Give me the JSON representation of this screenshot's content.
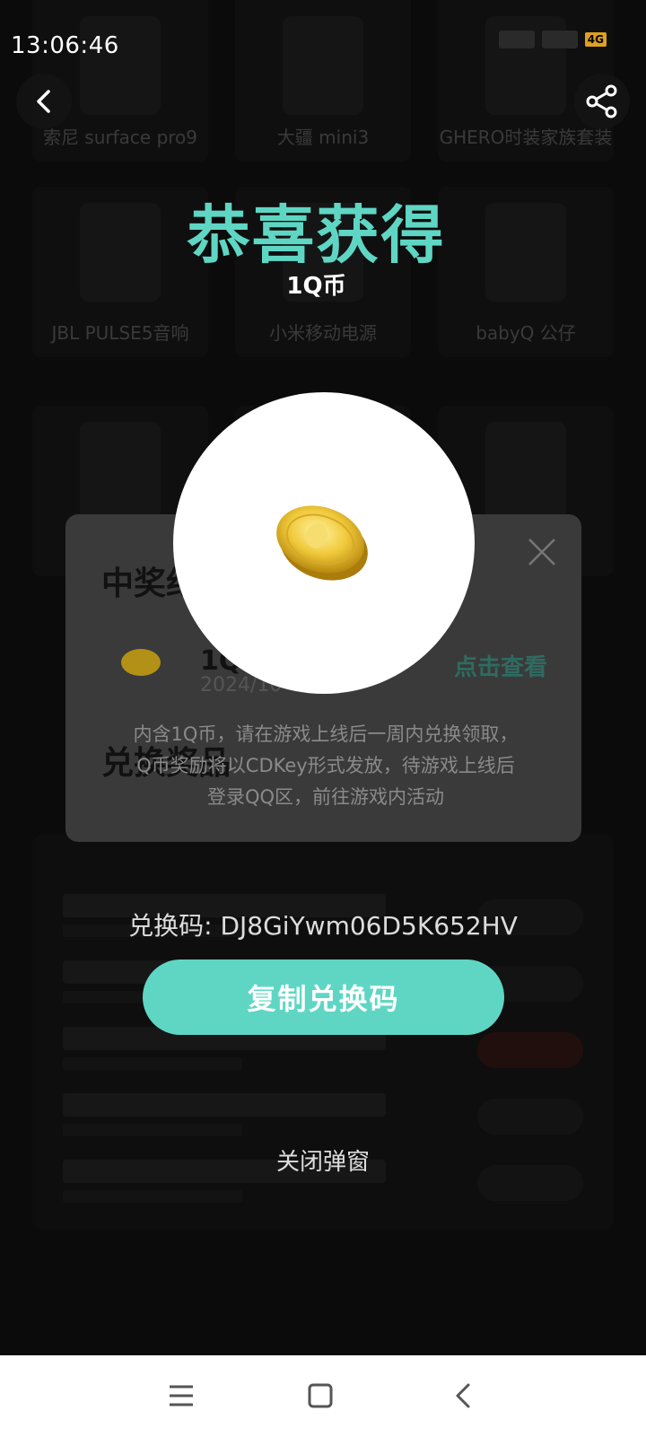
{
  "status_bar": {
    "time": "13:06:46",
    "network_badge": "4G"
  },
  "header": {
    "back_icon": "chevron-left-icon",
    "share_icon": "share-icon"
  },
  "background": {
    "top_prizes": [
      "索尼 surface pro9",
      "大疆 mini3",
      "GHERO时装家族套装"
    ],
    "mid_prizes": [
      "JBL PULSE5音响",
      "小米移动电源",
      "babyQ 公仔"
    ],
    "record_title": "中奖纪录",
    "record_item_name": "1Q币",
    "record_item_date": "2024/10",
    "record_view": "点击查看",
    "record_desc": "内含1Q币，请在游戏上线后一周内兑换领取，Q币奖励将以CDKey形式发放，待游戏上线后登录QQ区，前往游戏内活动",
    "redeem_title": "兑换奖品"
  },
  "result": {
    "title": "恭喜获得",
    "prize": "1Q币",
    "code_label": "兑换码: ",
    "code": "DJ8GiYwm06D5K652HV",
    "copy_button": "复制兑换码",
    "close_link": "关闭弹窗"
  },
  "colors": {
    "accent": "#5fd6c4",
    "coin_gold": "#e8c23a",
    "panel": "#3a3a3a"
  },
  "navbar": {
    "icons": [
      "menu-icon",
      "home-square-icon",
      "back-icon"
    ]
  }
}
